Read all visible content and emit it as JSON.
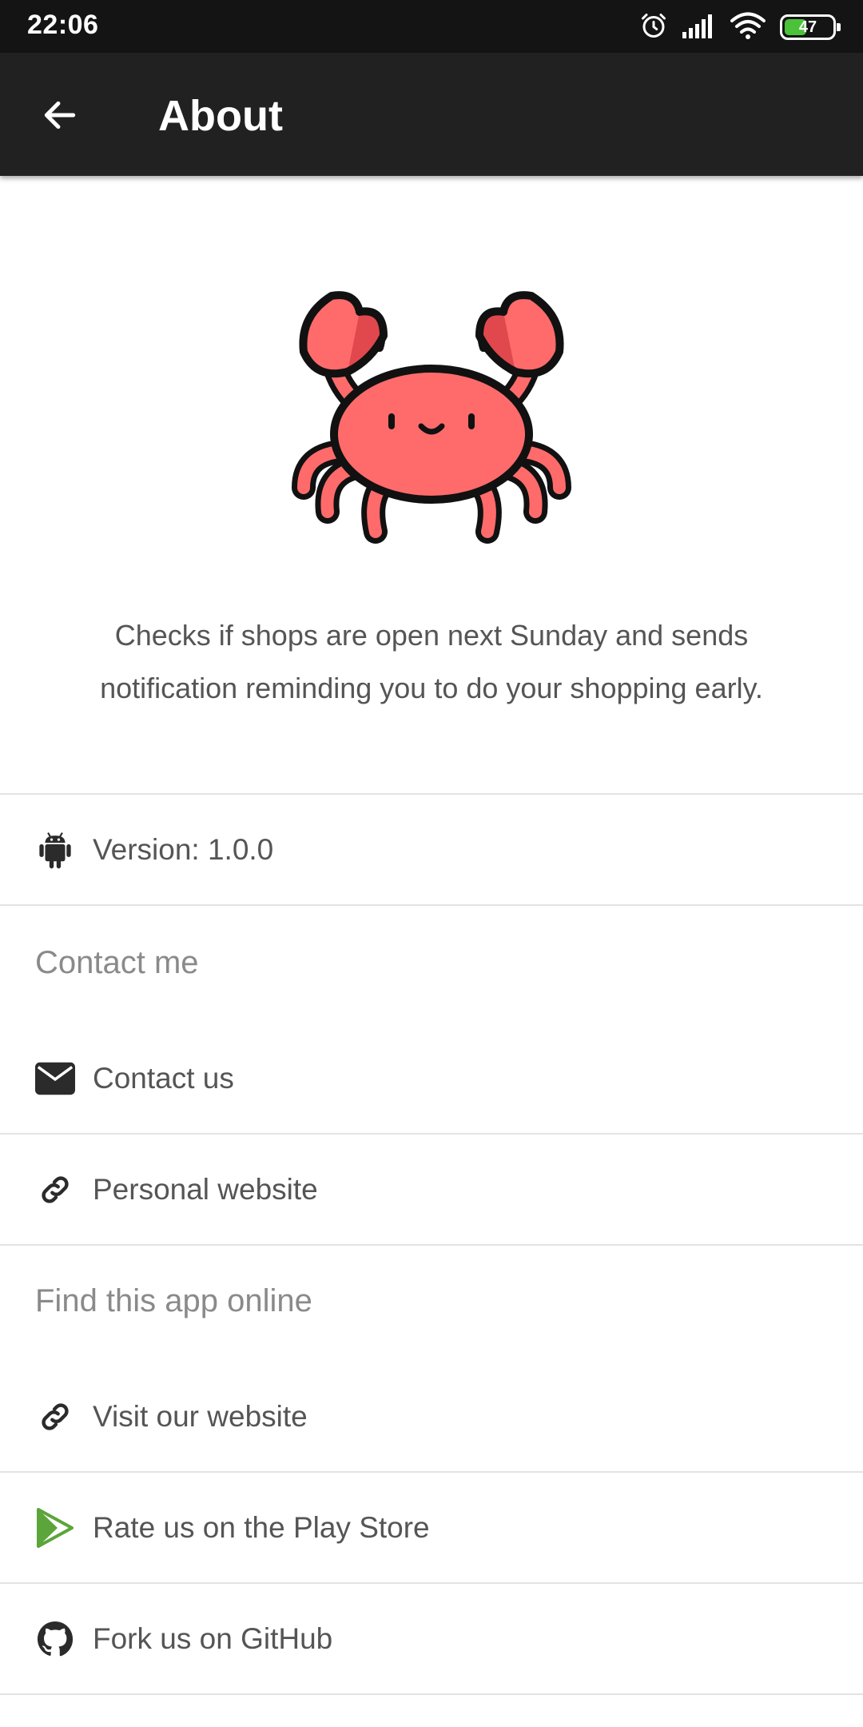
{
  "status_bar": {
    "time": "22:06",
    "battery": 47,
    "icons": [
      "alarm-icon",
      "signal-icon",
      "wifi-icon",
      "battery-icon"
    ]
  },
  "app_bar": {
    "title": "About",
    "back_icon": "arrow-left-icon"
  },
  "about": {
    "logo": "crab-illustration",
    "description": "Checks if shops are open next Sunday and sends notification reminding you to do your shopping early."
  },
  "items": {
    "version": {
      "label": "Version: 1.0.0",
      "icon": "android-icon"
    }
  },
  "sections": {
    "contact": {
      "header": "Contact me",
      "items": [
        {
          "label": "Contact us",
          "icon": "envelope-icon"
        },
        {
          "label": "Personal website",
          "icon": "link-icon"
        }
      ]
    },
    "online": {
      "header": "Find this app online",
      "items": [
        {
          "label": "Visit our website",
          "icon": "link-icon"
        },
        {
          "label": "Rate us on the Play Store",
          "icon": "play-store-icon"
        },
        {
          "label": "Fork us on GitHub",
          "icon": "github-icon"
        }
      ]
    }
  },
  "colors": {
    "app_bar": "#212121",
    "status_bar": "#141414",
    "crab": "#ff6b6b",
    "crab_dark": "#e0484d",
    "play_green": "#5ca53a",
    "battery": "#4cc23b"
  }
}
